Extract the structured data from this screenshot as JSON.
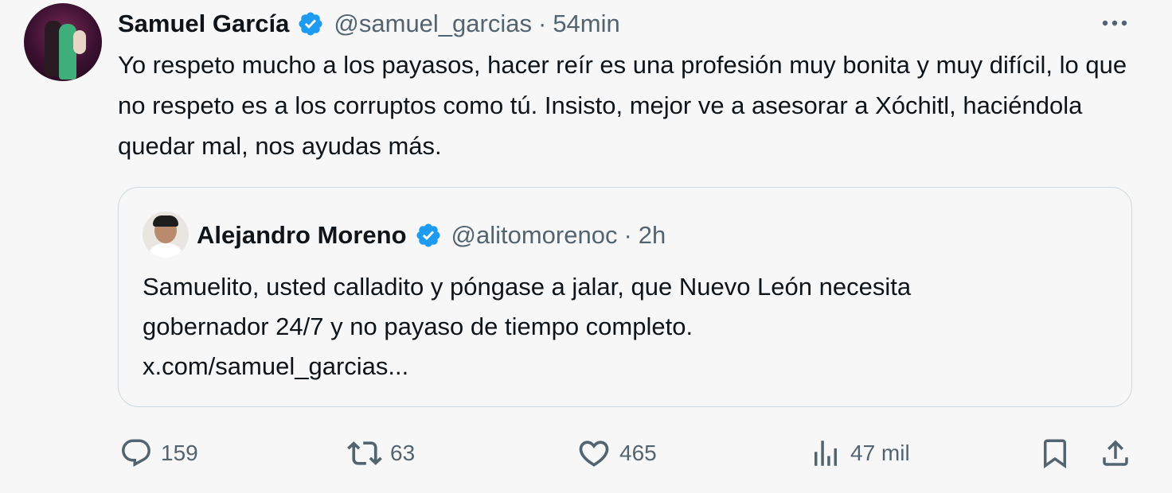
{
  "tweet": {
    "author_name": "Samuel García",
    "author_handle": "@samuel_garcias",
    "separator": "·",
    "time": "54min",
    "text": "Yo respeto mucho a los payasos, hacer reír es una profesión muy bonita y muy difícil, lo que no respeto es a los corruptos como tú. Insisto, mejor ve a asesorar a Xóchitl, haciéndola quedar mal, nos ayudas más."
  },
  "quote": {
    "author_name": "Alejandro Moreno",
    "author_handle": "@alitomorenoc",
    "separator": "·",
    "time": "2h",
    "text_line1": "Samuelito, usted calladito y póngase a jalar, que Nuevo León necesita",
    "text_line2": "gobernador 24/7 y no payaso de tiempo completo.",
    "link": "x.com/samuel_garcias..."
  },
  "actions": {
    "replies": "159",
    "reposts": "63",
    "likes": "465",
    "views": "47 mil"
  },
  "icons": {
    "verified": "verified-badge-icon",
    "more": "more-horizontal-icon",
    "reply": "reply-bubble-icon",
    "repost": "repost-arrows-icon",
    "like": "heart-icon",
    "views": "bar-chart-icon",
    "bookmark": "bookmark-icon",
    "share": "share-upload-icon"
  },
  "colors": {
    "verified_blue": "#1d9bf0",
    "secondary_text": "#536471",
    "primary_text": "#0f1419",
    "background": "#f7f7f7",
    "border": "#cfd9de"
  }
}
